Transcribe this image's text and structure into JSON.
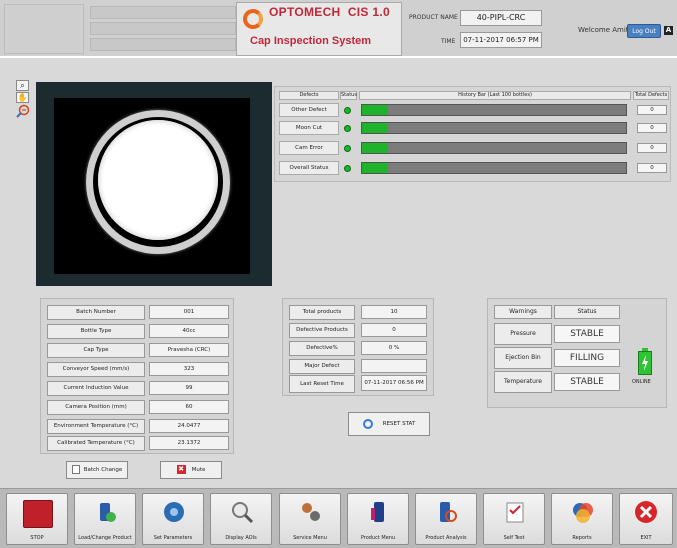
{
  "header": {
    "brand": "OPTOMECH",
    "version": "CIS 1.0",
    "subtitle": "Cap Inspection System",
    "product_label": "PRODUCT NAME",
    "product_name": "40-PIPL-CRC",
    "time_label": "TIME",
    "time_value": "07-11-2017  06:57 PM",
    "welcome": "Welcome Amit",
    "logout_label": "Log Out",
    "logout_icon": "A"
  },
  "defects": {
    "headers": [
      "Defects",
      "Status",
      "History Bar (Last 100 bottles)",
      "Total Defects"
    ],
    "rows": [
      {
        "label": "Other Defect",
        "total": "0",
        "fill": 0.1
      },
      {
        "label": "Moon Cut",
        "total": "0",
        "fill": 0.1
      },
      {
        "label": "Cam Error",
        "total": "0",
        "fill": 0.1
      },
      {
        "label": "Overall Status",
        "total": "0",
        "fill": 0.1
      }
    ],
    "status_color": "#19b52a"
  },
  "batch": {
    "rows": [
      {
        "label": "Batch Number",
        "value": "001"
      },
      {
        "label": "Bottle Type",
        "value": "40cc"
      },
      {
        "label": "Cap Type",
        "value": "Pravesha (CRC)"
      },
      {
        "label": "Conveyor Speed (mm/s)",
        "value": "323"
      },
      {
        "label": "Current Induction Value",
        "value": "99"
      },
      {
        "label": "Camera Position (mm)",
        "value": "60"
      },
      {
        "label": "Environment Temperature (°C)",
        "value": "24.0477"
      },
      {
        "label": "Calibrated Temperature (°C)",
        "value": "23.1372"
      }
    ],
    "batch_change_label": "Batch Change",
    "mute_label": "Mute"
  },
  "totals": {
    "rows": [
      {
        "label": "Total products",
        "value": "10"
      },
      {
        "label": "Defective Products",
        "value": "0"
      },
      {
        "label": "Defective%",
        "value": "0 %"
      },
      {
        "label": "Major Defect",
        "value": ""
      },
      {
        "label": "Last Reset Time",
        "value": "07-11-2017  06:56 PM"
      }
    ],
    "reset_label": "RESET STAT"
  },
  "warnings": {
    "headers": [
      "Warnings",
      "Status"
    ],
    "rows": [
      {
        "label": "Pressure",
        "value": "STABLE"
      },
      {
        "label": "Ejection Bin",
        "value": "FILLING"
      },
      {
        "label": "Temperature",
        "value": "STABLE"
      }
    ],
    "online_label": "ONLINE"
  },
  "toolbar": {
    "items": [
      {
        "label": "STOP",
        "icon": "stop-icon"
      },
      {
        "label": "Load/Change Product",
        "icon": "load-product-icon"
      },
      {
        "label": "Set Parameters",
        "icon": "parameters-icon"
      },
      {
        "label": "Display AOIs",
        "icon": "magnifier-icon"
      },
      {
        "label": "Service Menu",
        "icon": "service-icon"
      },
      {
        "label": "Product Menu",
        "icon": "product-menu-icon"
      },
      {
        "label": "Product Analysis",
        "icon": "analysis-icon"
      },
      {
        "label": "Self Test",
        "icon": "self-test-icon"
      },
      {
        "label": "Reports",
        "icon": "reports-icon"
      },
      {
        "label": "EXIT",
        "icon": "exit-icon"
      }
    ]
  }
}
